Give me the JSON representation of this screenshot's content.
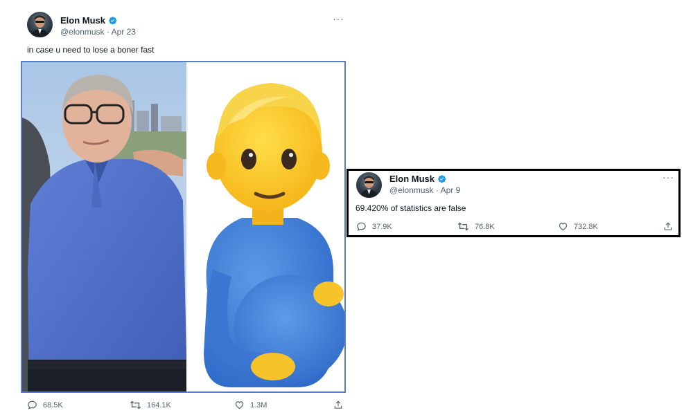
{
  "tweet1": {
    "author_name": "Elon Musk",
    "handle": "@elonmusk",
    "date": "Apr 23",
    "more": "···",
    "text": "in case u need to lose a boner fast",
    "replies": "68.5K",
    "retweets": "164.1K",
    "likes": "1.3M"
  },
  "tweet2": {
    "author_name": "Elon Musk",
    "handle": "@elonmusk",
    "date": "Apr 9",
    "more": "···",
    "text": "69.420% of statistics are false",
    "replies": "37.9K",
    "retweets": "76.8K",
    "likes": "732.8K"
  },
  "icons": {
    "verified": "verified-badge-icon",
    "reply": "reply-icon",
    "retweet": "retweet-icon",
    "like": "heart-icon",
    "share": "share-icon"
  },
  "colors": {
    "verified": "#1d9bf0",
    "secondary_text": "#536471",
    "media_border": "#5a7fc0"
  }
}
